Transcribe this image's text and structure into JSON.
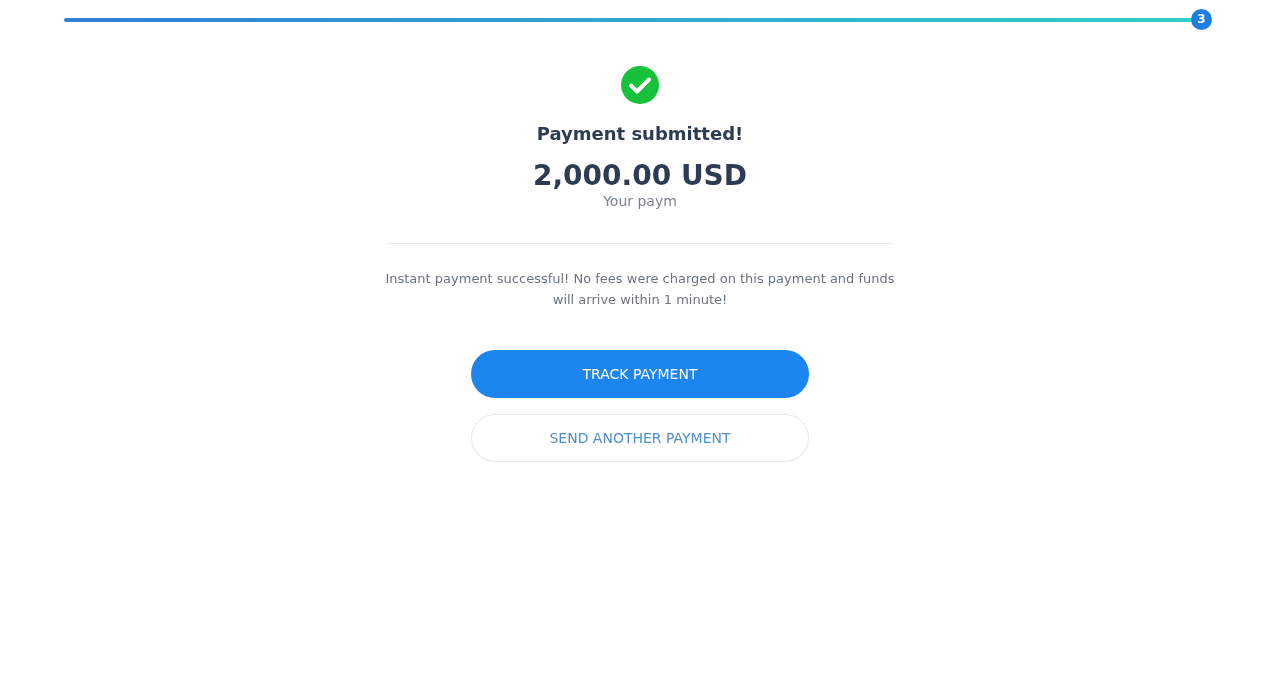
{
  "progress": {
    "level": 1,
    "step": "3"
  },
  "status": {
    "title": "Payment submitted!",
    "amount": "2,000.00 USD",
    "detail": "Your paym"
  },
  "message": "Instant payment successful! No fees were charged on this payment and funds will arrive within 1 minute!",
  "buttons": [
    {
      "label": "TRACK PAYMENT",
      "kind": "primary"
    },
    {
      "label": "SEND ANOTHER PAYMENT",
      "kind": "outline"
    }
  ]
}
